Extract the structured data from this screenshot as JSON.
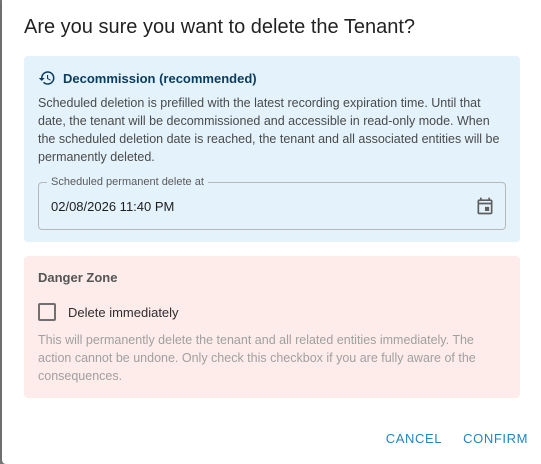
{
  "dialog": {
    "title": "Are you sure you want to delete the Tenant?"
  },
  "decommission": {
    "icon": "history-icon",
    "heading": "Decommission (recommended)",
    "description": "Scheduled deletion is prefilled with the latest recording expiration time. Until that date, the tenant will be decommissioned and accessible in read-only mode. When the scheduled deletion date is reached, the tenant and all associated entities will be permanently deleted.",
    "date_field": {
      "label": "Scheduled permanent delete at",
      "value": "02/08/2026 11:40 PM",
      "icon": "calendar-icon"
    }
  },
  "danger_zone": {
    "title": "Danger Zone",
    "checkbox_label": "Delete immediately",
    "checked": false,
    "warning": "This will permanently delete the tenant and all related entities immediately. The action cannot be undone. Only check this checkbox if you are fully aware of the consequences."
  },
  "actions": {
    "cancel_label": "CANCEL",
    "confirm_label": "CONFIRM"
  },
  "colors": {
    "info_background": "#e3f2fb",
    "danger_background": "#fdecea",
    "accent": "#2286c3"
  }
}
